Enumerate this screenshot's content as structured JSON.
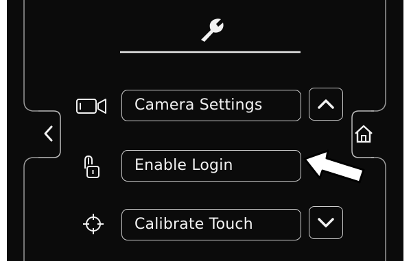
{
  "colors": {
    "background": "#0b0b0b",
    "foreground": "#f2f2f2",
    "outline": "#cfcfcf",
    "pointer": "#ffffff"
  },
  "header": {
    "icon": "wrench-icon"
  },
  "navigation": {
    "back_icon": "chevron-left-icon",
    "home_icon": "home-icon"
  },
  "menu": {
    "items": [
      {
        "label": "Camera Settings",
        "icon": "camera-icon"
      },
      {
        "label": "Enable Login",
        "icon": "lock-icon"
      },
      {
        "label": "Calibrate Touch",
        "icon": "crosshair-icon"
      }
    ],
    "scroll_up_icon": "chevron-up-icon",
    "scroll_down_icon": "chevron-down-icon"
  },
  "annotation": {
    "icon": "pointer-arrow-icon"
  }
}
